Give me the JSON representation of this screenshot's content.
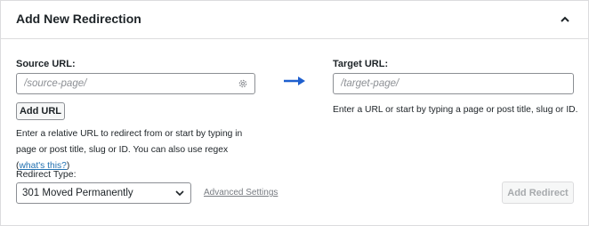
{
  "panel": {
    "title": "Add New Redirection",
    "collapse_icon": "chevron-up-icon"
  },
  "source": {
    "label": "Source URL:",
    "placeholder": "/source-page/",
    "settings_icon": "gear-icon",
    "add_url_label": "Add URL",
    "help_text": "Enter a relative URL to redirect from or start by typing in page or post title, slug or ID. You can also use regex (",
    "help_link": "what's this?",
    "help_close": ")"
  },
  "arrow_icon": "arrow-right-icon",
  "target": {
    "label": "Target URL:",
    "placeholder": "/target-page/",
    "help_text": "Enter a URL or start by typing a page or post title, slug or ID."
  },
  "redirect_type": {
    "label": "Redirect Type:",
    "selected": "301 Moved Permanently",
    "dropdown_icon": "chevron-down-icon"
  },
  "advanced_settings_label": "Advanced Settings",
  "add_redirect_label": "Add Redirect",
  "colors": {
    "accent": "#1e5fce",
    "link": "#2271b1",
    "disabled_text": "#a7aaad"
  }
}
